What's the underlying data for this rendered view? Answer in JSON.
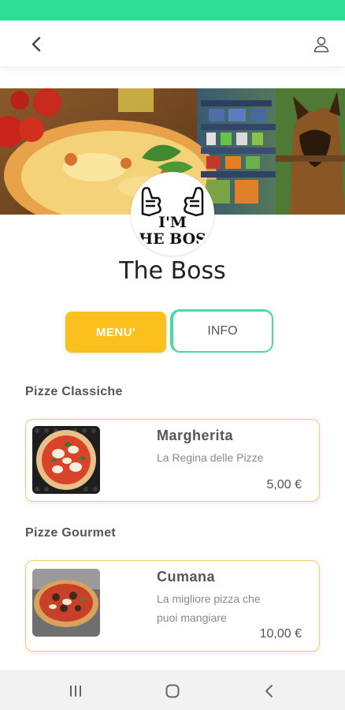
{
  "header": {
    "back_icon": "chevron-left-icon",
    "user_icon": "user-icon"
  },
  "restaurant": {
    "name": "The Boss",
    "logo_text_top": "I'M",
    "logo_text_bottom": "HE BOS"
  },
  "tabs": [
    {
      "label": "MENU'",
      "active": true
    },
    {
      "label": "INFO",
      "active": false
    }
  ],
  "sections": [
    {
      "title": "Pizze Classiche",
      "items": [
        {
          "name": "Margherita",
          "desc": "La Regina delle Pizze",
          "price": "5,00 €"
        }
      ]
    },
    {
      "title": "Pizze Gourmet",
      "items": [
        {
          "name": "Cumana",
          "desc": "La migliore pizza che puoi mangiare",
          "price": "10,00 €"
        }
      ]
    }
  ],
  "colors": {
    "status_bar": "#2fdc97",
    "accent_yellow": "#f9c01e",
    "accent_green": "#49d9a4",
    "card_border": "#f5cc5e"
  },
  "system_nav": {
    "recents_icon": "recents-icon",
    "home_icon": "home-icon",
    "back_icon": "back-icon"
  }
}
